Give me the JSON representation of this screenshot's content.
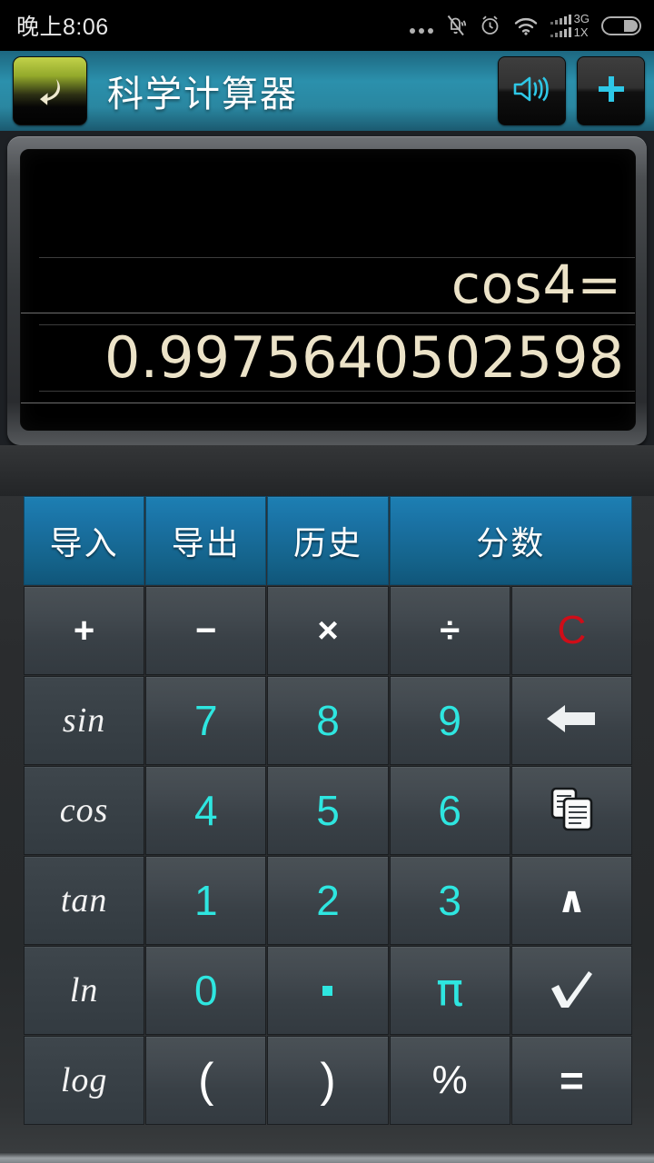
{
  "statusbar": {
    "time": "晚上8:06",
    "icons": [
      "more-dots-icon",
      "bell-muted-icon",
      "alarm-clock-icon",
      "wifi-icon",
      "signal-bars-icon",
      "battery-icon"
    ],
    "network_primary": "3G",
    "network_secondary": "1X"
  },
  "titlebar": {
    "back_label": "back-arrow-icon",
    "title": "科学计算器",
    "sound_label": "speaker-icon",
    "add_label": "plus-icon",
    "accent_color": "#2b90ac",
    "icon_color": "#2ee6e0"
  },
  "display": {
    "expression": "cos4=",
    "result": "0.9975640502598",
    "text_color": "#ece3c8",
    "bg_color": "#000000"
  },
  "keypad": {
    "blue_color": "#1a72a4",
    "number_color": "#2ee6e0",
    "clear_color": "#cf0d18",
    "rows": [
      [
        {
          "name": "import-button",
          "label": "导入",
          "type": "blue"
        },
        {
          "name": "export-button",
          "label": "导出",
          "type": "blue"
        },
        {
          "name": "history-button",
          "label": "历史",
          "type": "blue"
        },
        {
          "name": "fraction-button",
          "label": "分数",
          "type": "blue",
          "span": 2
        }
      ],
      [
        {
          "name": "plus-button",
          "label": "+",
          "type": "op"
        },
        {
          "name": "minus-button",
          "label": "−",
          "type": "op"
        },
        {
          "name": "multiply-button",
          "label": "×",
          "type": "op"
        },
        {
          "name": "divide-button",
          "label": "÷",
          "type": "op"
        },
        {
          "name": "clear-button",
          "label": "C",
          "type": "red"
        }
      ],
      [
        {
          "name": "sin-button",
          "label": "sin",
          "type": "trig"
        },
        {
          "name": "digit-7-button",
          "label": "7",
          "type": "num"
        },
        {
          "name": "digit-8-button",
          "label": "8",
          "type": "num"
        },
        {
          "name": "digit-9-button",
          "label": "9",
          "type": "num"
        },
        {
          "name": "backspace-button",
          "label": "backspace-arrow-icon",
          "type": "icon-backspace"
        }
      ],
      [
        {
          "name": "cos-button",
          "label": "cos",
          "type": "trig"
        },
        {
          "name": "digit-4-button",
          "label": "4",
          "type": "num"
        },
        {
          "name": "digit-5-button",
          "label": "5",
          "type": "num"
        },
        {
          "name": "digit-6-button",
          "label": "6",
          "type": "num"
        },
        {
          "name": "copy-button",
          "label": "copy-icon",
          "type": "icon-copy"
        }
      ],
      [
        {
          "name": "tan-button",
          "label": "tan",
          "type": "trig"
        },
        {
          "name": "digit-1-button",
          "label": "1",
          "type": "num"
        },
        {
          "name": "digit-2-button",
          "label": "2",
          "type": "num"
        },
        {
          "name": "digit-3-button",
          "label": "3",
          "type": "num"
        },
        {
          "name": "power-button",
          "label": "∧",
          "type": "caret"
        }
      ],
      [
        {
          "name": "ln-button",
          "label": "ln",
          "type": "trig"
        },
        {
          "name": "digit-0-button",
          "label": "0",
          "type": "num"
        },
        {
          "name": "decimal-point-button",
          "label": "·",
          "type": "dot"
        },
        {
          "name": "pi-button",
          "label": "π",
          "type": "pi"
        },
        {
          "name": "sqrt-button",
          "label": "checkmark-icon",
          "type": "icon-check"
        }
      ],
      [
        {
          "name": "log-button",
          "label": "log",
          "type": "trig"
        },
        {
          "name": "left-paren-button",
          "label": "(",
          "type": "paren"
        },
        {
          "name": "right-paren-button",
          "label": ")",
          "type": "paren"
        },
        {
          "name": "percent-button",
          "label": "%",
          "type": "pct"
        },
        {
          "name": "equals-button",
          "label": "=",
          "type": "eq"
        }
      ]
    ]
  }
}
